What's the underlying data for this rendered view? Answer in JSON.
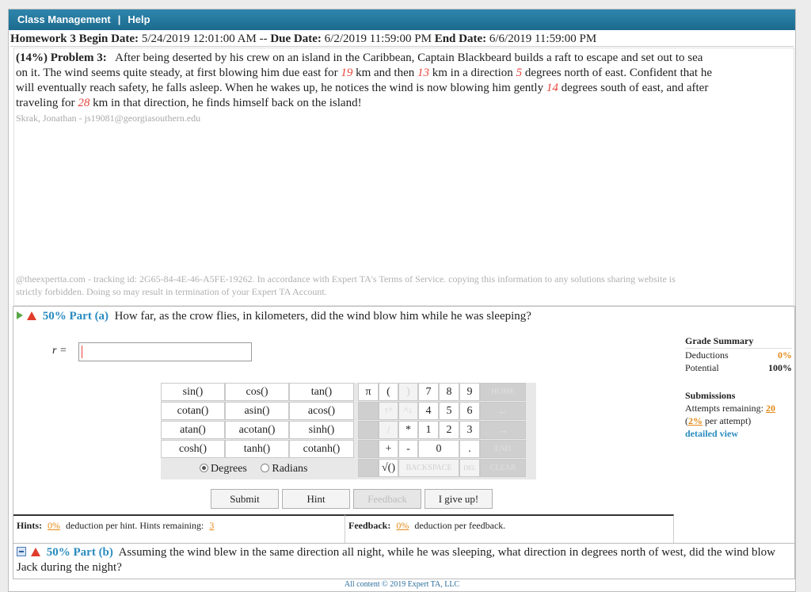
{
  "topbar": {
    "class_management": "Class Management",
    "separator": "|",
    "help": "Help"
  },
  "homework": {
    "begin_label": "Homework 3 Begin Date:",
    "begin": "5/24/2019 12:01:00 AM",
    "sep": "--",
    "due_label": "Due Date:",
    "due": "6/2/2019 11:59:00 PM",
    "end_label": "End Date:",
    "end": "6/6/2019 11:59:00 PM"
  },
  "problem": {
    "label": "(14%) Problem 3:",
    "t1": "After being deserted by his crew on an island in the Caribbean, Captain Blackbeard builds a raft to escape and set out to sea on it. The wind seems quite steady, at first blowing him due east for ",
    "v1": "19",
    "t2": " km and then ",
    "v2": "13",
    "t3": " km in a direction ",
    "v3": "5",
    "t4": " degrees north of east. Confident that he will eventually reach safety, he falls asleep. When he wakes up, he notices the wind is now blowing him gently ",
    "v4": "14",
    "t5": " degrees south of east, and after traveling for ",
    "v5": "28",
    "t6": " km in that direction, he finds himself back on the island!",
    "student": "Skrak, Jonathan - js19081@georgiasouthern.edu",
    "tracking": "@theexpertta.com - tracking id: 2G65-84-4E-46-A5FE-19262. In accordance with Expert TA's Terms of Service. copying this information to any solutions sharing website is strictly forbidden. Doing so may result in termination of your Expert TA Account."
  },
  "part_a": {
    "pct": "50% Part (a)",
    "question": "How far, as the crow flies, in kilometers, did the wind blow him while he was sleeping?",
    "var_label": "r =",
    "input_value": ""
  },
  "calculator": {
    "funcs": [
      "sin()",
      "cos()",
      "tan()",
      "cotan()",
      "asin()",
      "acos()",
      "atan()",
      "acotan()",
      "sinh()",
      "cosh()",
      "tanh()",
      "cotanh()"
    ],
    "pi": "π",
    "lparen": "(",
    "rparen": ")",
    "up": "↑^",
    "down": "^↓",
    "slash": "/",
    "star": "*",
    "plus": "+",
    "minus": "-",
    "sqrt": "√()",
    "backspace": "BACKSPACE",
    "del": "DEL",
    "clear": "CLEAR",
    "home": "HOME",
    "left": "←",
    "right": "→",
    "end": "END",
    "dot": ".",
    "digits": [
      "7",
      "8",
      "9",
      "4",
      "5",
      "6",
      "1",
      "2",
      "3",
      "0"
    ],
    "degrees": "Degrees",
    "radians": "Radians"
  },
  "buttons": {
    "submit": "Submit",
    "hint": "Hint",
    "feedback": "Feedback",
    "give_up": "I give up!"
  },
  "hints": {
    "label": "Hints:",
    "pct": "0%",
    "text": "deduction per hint. Hints remaining:",
    "remaining": "3"
  },
  "feedback": {
    "label": "Feedback:",
    "pct": "0%",
    "text": "deduction per feedback."
  },
  "grade_summary": {
    "title": "Grade Summary",
    "deductions_label": "Deductions",
    "deductions": "0%",
    "potential_label": "Potential",
    "potential": "100%"
  },
  "submissions": {
    "title": "Submissions",
    "attempts_label": "Attempts remaining:",
    "attempts": "20",
    "per_open": "(",
    "per_pct": "2%",
    "per_text": "per attempt)",
    "detailed": "detailed view"
  },
  "part_b": {
    "pct": "50% Part (b)",
    "question": "Assuming the wind blew in the same direction all night, while he was sleeping, what direction in degrees north of west, did the wind blow Jack during the night?"
  },
  "footer": "All content © 2019 Expert TA, LLC",
  "colors": {
    "header": "#1c6a8e",
    "accent": "#2a8cc0",
    "given_value": "#e8453c",
    "orange": "#e38a17"
  }
}
